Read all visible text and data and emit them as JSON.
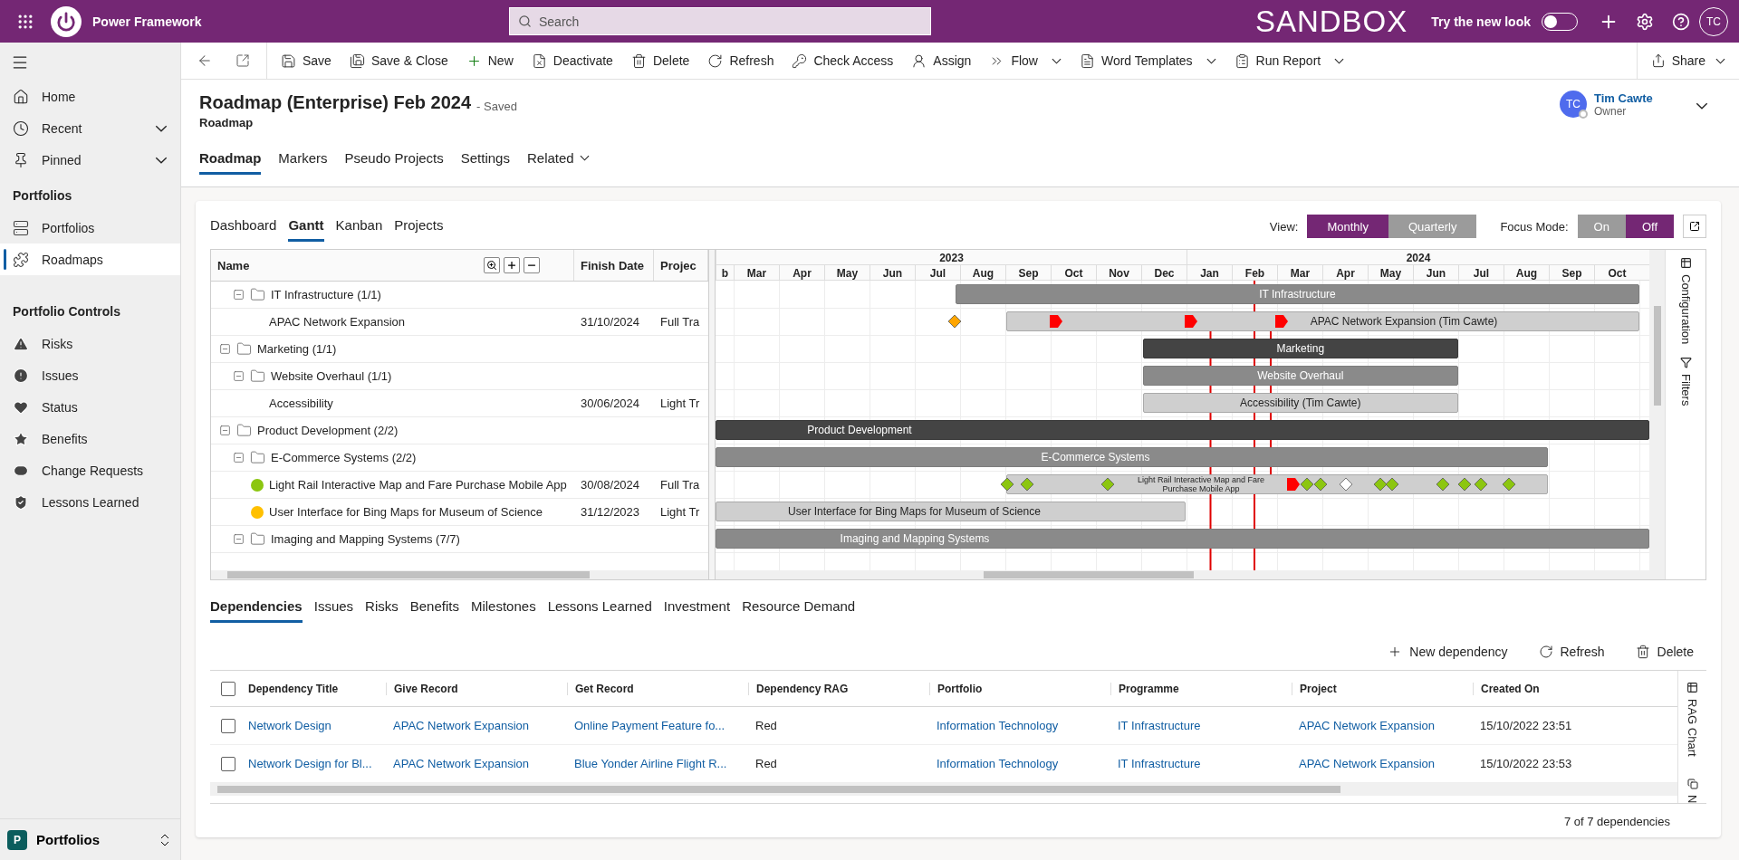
{
  "top_bar": {
    "app_name": "Power Framework",
    "search": {
      "placeholder": "Search"
    },
    "environment": "SANDBOX",
    "new_look": {
      "label": "Try the new look",
      "on": false
    },
    "user_initials": "TC"
  },
  "nav": {
    "items": [
      {
        "label": "Home",
        "selected": false
      },
      {
        "label": "Recent",
        "selected": false,
        "expanded": false
      },
      {
        "label": "Pinned",
        "selected": false,
        "expanded": false
      }
    ],
    "sections": [
      {
        "title": "Portfolios",
        "items": [
          {
            "label": "Portfolios",
            "selected": false
          },
          {
            "label": "Roadmaps",
            "selected": true
          }
        ]
      },
      {
        "title": "Portfolio Controls",
        "items": [
          {
            "label": "Risks",
            "selected": false
          },
          {
            "label": "Issues",
            "selected": false
          },
          {
            "label": "Status",
            "selected": false
          },
          {
            "label": "Benefits",
            "selected": false
          },
          {
            "label": "Change Requests",
            "selected": false
          },
          {
            "label": "Lessons Learned",
            "selected": false
          }
        ]
      }
    ],
    "area": {
      "initial": "P",
      "label": "Portfolios"
    }
  },
  "commands": [
    {
      "label": "Save",
      "menu": false
    },
    {
      "label": "Save & Close",
      "menu": false
    },
    {
      "label": "New",
      "menu": false
    },
    {
      "label": "Deactivate",
      "menu": false
    },
    {
      "label": "Delete",
      "menu": false
    },
    {
      "label": "Refresh",
      "menu": false
    },
    {
      "label": "Check Access",
      "menu": false
    },
    {
      "label": "Assign",
      "menu": false
    },
    {
      "label": "Flow",
      "menu": true
    },
    {
      "label": "Word Templates",
      "menu": true
    },
    {
      "label": "Run Report",
      "menu": true
    }
  ],
  "share": {
    "label": "Share",
    "menu": true
  },
  "record": {
    "title": "Roadmap (Enterprise) Feb 2024",
    "save_state": "- Saved",
    "entity": "Roadmap",
    "owner": {
      "initials": "TC",
      "name": "Tim Cawte",
      "role": "Owner"
    }
  },
  "tabs": [
    {
      "label": "Roadmap",
      "selected": true
    },
    {
      "label": "Markers",
      "selected": false
    },
    {
      "label": "Pseudo Projects",
      "selected": false
    },
    {
      "label": "Settings",
      "selected": false
    },
    {
      "label": "Related",
      "selected": false,
      "menu": true
    }
  ],
  "roadmap": {
    "tabs": [
      {
        "label": "Dashboard",
        "selected": false
      },
      {
        "label": "Gantt",
        "selected": true
      },
      {
        "label": "Kanban",
        "selected": false
      },
      {
        "label": "Projects",
        "selected": false
      }
    ],
    "view": {
      "label": "View:",
      "options": [
        {
          "label": "Monthly",
          "selected": true
        },
        {
          "label": "Quarterly",
          "selected": false
        }
      ]
    },
    "focus_mode": {
      "label": "Focus Mode:",
      "options": [
        {
          "label": "On",
          "selected": false
        },
        {
          "label": "Off",
          "selected": true
        }
      ]
    }
  },
  "gantt": {
    "columns": [
      "Name",
      "Finish Date",
      "Projec"
    ],
    "years": [
      "2023",
      "2024"
    ],
    "months": [
      "b",
      "Mar",
      "Apr",
      "May",
      "Jun",
      "Jul",
      "Aug",
      "Sep",
      "Oct",
      "Nov",
      "Dec",
      "Jan",
      "Feb",
      "Mar",
      "Apr",
      "May",
      "Jun",
      "Jul",
      "Aug",
      "Sep",
      "Oct"
    ],
    "rows": [
      {
        "children": [
          {
            "name": "IT Infrastructure (1/1)",
            "expanded": true,
            "bar": {
              "label": "IT Infrastructure"
            },
            "children": [
              {
                "name": "APAC Network Expansion",
                "finish_date": "31/10/2024",
                "project": "Full Tra",
                "bar": {
                  "label": "APAC Network Expansion (Tim Cawte)"
                },
                "milestones": [
                  {
                    "kind": "diamond",
                    "color": "#ffa500"
                  },
                  {
                    "kind": "flag",
                    "color": "#ff0000"
                  },
                  {
                    "kind": "flag",
                    "color": "#ff0000"
                  },
                  {
                    "kind": "flag",
                    "color": "#ff0000"
                  }
                ]
              }
            ]
          }
        ]
      },
      {
        "name": "Marketing (1/1)",
        "expanded": true,
        "bar": {
          "label": "Marketing"
        },
        "children": [
          {
            "name": "Website Overhaul (1/1)",
            "expanded": true,
            "bar": {
              "label": "Website Overhaul"
            },
            "children": [
              {
                "name": "Accessibility",
                "finish_date": "30/06/2024",
                "project": "Light Tr",
                "bar": {
                  "label": "Accessibility (Tim Cawte)"
                }
              }
            ]
          }
        ]
      },
      {
        "name": "Product Development (2/2)",
        "expanded": true,
        "bar": {
          "label": "Product Development"
        },
        "children": [
          {
            "name": "E-Commerce Systems (2/2)",
            "expanded": true,
            "bar": {
              "label": "E-Commerce Systems"
            },
            "children": [
              {
                "name": "Light Rail Interactive Map and Fare Purchase Mobile App",
                "color": "#8cc610",
                "finish_date": "30/08/2024",
                "project": "Full Tra",
                "bar": {
                  "label": "Light Rail Interactive Map and Fare Purchase Mobile App"
                },
                "milestones": [
                  {
                    "kind": "diamond",
                    "color": "#8cc610"
                  },
                  {
                    "kind": "diamond",
                    "color": "#8cc610"
                  },
                  {
                    "kind": "diamond",
                    "color": "#8cc610"
                  },
                  {
                    "kind": "flag",
                    "color": "#ff0000"
                  },
                  {
                    "kind": "diamond",
                    "color": "#8cc610"
                  },
                  {
                    "kind": "diamond",
                    "color": "#8cc610"
                  },
                  {
                    "kind": "diamond",
                    "color": "#ffffff"
                  },
                  {
                    "kind": "diamond",
                    "color": "#8cc610"
                  },
                  {
                    "kind": "diamond",
                    "color": "#8cc610"
                  },
                  {
                    "kind": "diamond",
                    "color": "#8cc610"
                  },
                  {
                    "kind": "diamond",
                    "color": "#8cc610"
                  },
                  {
                    "kind": "diamond",
                    "color": "#8cc610"
                  },
                  {
                    "kind": "diamond",
                    "color": "#8cc610"
                  }
                ]
              },
              {
                "name": "User Interface for Bing Maps for Museum of Science",
                "color": "#ffc000",
                "finish_date": "31/12/2023",
                "project": "Light Tr",
                "bar": {
                  "label": "User Interface for Bing Maps for Museum of Science"
                }
              }
            ]
          },
          {
            "name": "Imaging and Mapping Systems (7/7)",
            "expanded": true,
            "bar": {
              "label": "Imaging and Mapping Systems"
            }
          }
        ]
      }
    ],
    "side_panel": [
      "Configuration",
      "Filters"
    ]
  },
  "related_tabs": [
    {
      "label": "Dependencies",
      "selected": true
    },
    {
      "label": "Issues",
      "selected": false
    },
    {
      "label": "Risks",
      "selected": false
    },
    {
      "label": "Benefits",
      "selected": false
    },
    {
      "label": "Milestones",
      "selected": false
    },
    {
      "label": "Lessons Learned",
      "selected": false
    },
    {
      "label": "Investment",
      "selected": false
    },
    {
      "label": "Resource Demand",
      "selected": false
    }
  ],
  "table_actions": [
    "New dependency",
    "Refresh",
    "Delete"
  ],
  "table": {
    "all_checked": false,
    "columns": [
      {
        "label": "Dependency Title",
        "kind": "link"
      },
      {
        "label": "Give Record",
        "kind": "link"
      },
      {
        "label": "Get Record",
        "kind": "link"
      },
      {
        "label": "Dependency RAG",
        "kind": "text"
      },
      {
        "label": "Portfolio",
        "kind": "link"
      },
      {
        "label": "Programme",
        "kind": "link"
      },
      {
        "label": "Project",
        "kind": "link"
      },
      {
        "label": "Created On",
        "kind": "text"
      }
    ],
    "rows": [
      {
        "checked": false,
        "cells": [
          "Network Design",
          "APAC Network Expansion",
          "Online Payment Feature fo...",
          "Red",
          "Information Technology",
          "IT Infrastructure",
          "APAC Network Expansion",
          "15/10/2022 23:51"
        ]
      },
      {
        "checked": false,
        "cells": [
          "Network Design for Bl...",
          "APAC Network Expansion",
          "Blue Yonder Airline Flight R...",
          "Red",
          "Information Technology",
          "IT Infrastructure",
          "APAC Network Expansion",
          "15/10/2022 23:53"
        ]
      }
    ],
    "footer": "7 of 7 dependencies",
    "side_panel": [
      "RAG Chart",
      "N"
    ]
  }
}
